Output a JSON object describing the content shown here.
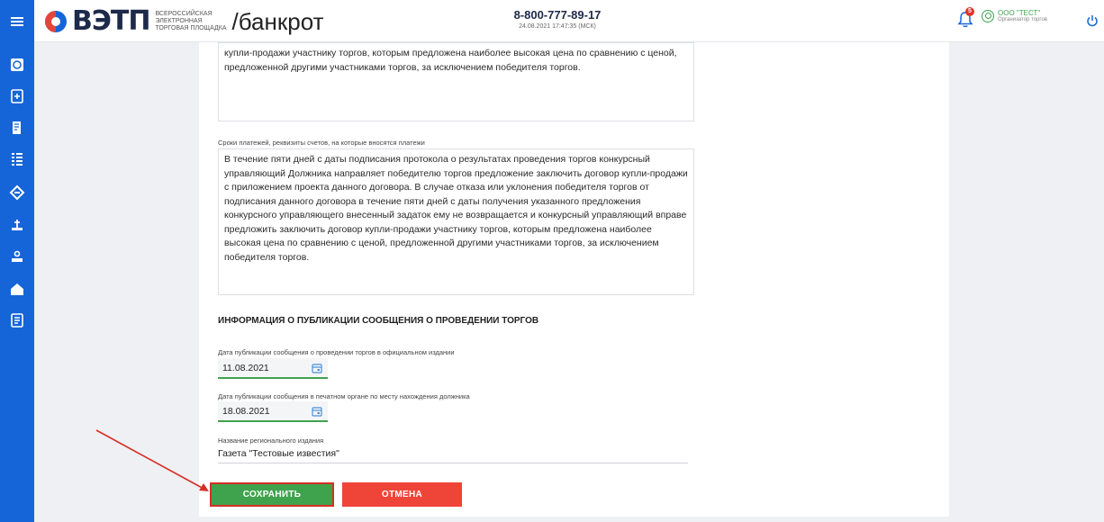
{
  "header": {
    "logo_text": "ВЭТП",
    "logo_sub_line1": "ВСЕРОССИЙСКАЯ",
    "logo_sub_line2": "ЭЛЕКТРОННАЯ",
    "logo_sub_line3": "ТОРГОВАЯ ПЛОЩАДКА",
    "section": "/банкрот",
    "phone": "8-800-777-89-17",
    "datetime": "24.08.2021 17:47:35 (МСК)",
    "notifications_count": "5",
    "user_name": "ООО \"ТЕСТ\"",
    "user_role": "Организатор торгов"
  },
  "sidebar": {
    "icons": [
      "globe-icon",
      "document-add-icon",
      "contract-icon",
      "list-icon",
      "gavel-icon",
      "scale-icon",
      "auction-icon",
      "house-icon",
      "report-icon"
    ]
  },
  "form": {
    "textarea1_text": "купли-продажи участнику торгов, которым предложена наиболее высокая цена по сравнению с ценой, предложенной другими участниками торгов, за исключением победителя торгов.",
    "payment_terms_label": "Сроки платежей, реквизиты счетов, на которые вносятся платежи",
    "payment_terms_text": "В течение пяти дней с даты подписания протокола о результатах проведения торгов конкурсный управляющий Должника направляет победителю торгов предложение заключить договор купли-продажи с приложением проекта данного договора. В случае отказа или уклонения победителя торгов от подписания данного договора в течение пяти дней с даты получения указанного предложения конкурсного управляющего внесенный задаток ему не возвращается и конкурсный управляющий вправе предложить заключить договор купли-продажи участнику торгов, которым предложена наиболее высокая цена по сравнению с ценой, предложенной другими участниками торгов, за исключением победителя торгов.",
    "publication_section_title": "ИНФОРМАЦИЯ О ПУБЛИКАЦИИ СООБЩЕНИЯ О ПРОВЕДЕНИИ ТОРГОВ",
    "official_pub_label": "Дата публикации сообщения о проведении торгов в официальном издании",
    "official_pub_date": "11.08.2021",
    "print_pub_label": "Дата публикации сообщения в печатном органе по месту нахождения должника",
    "print_pub_date": "18.08.2021",
    "regional_label": "Название регионального издания",
    "regional_value": "Газета \"Тестовые известия\"",
    "save_label": "СОХРАНИТЬ",
    "cancel_label": "ОТМЕНА"
  },
  "colors": {
    "brand_blue": "#1565d8",
    "save_green": "#3fa34d",
    "cancel_red": "#ef4438",
    "annotation_red": "#d52e25"
  }
}
